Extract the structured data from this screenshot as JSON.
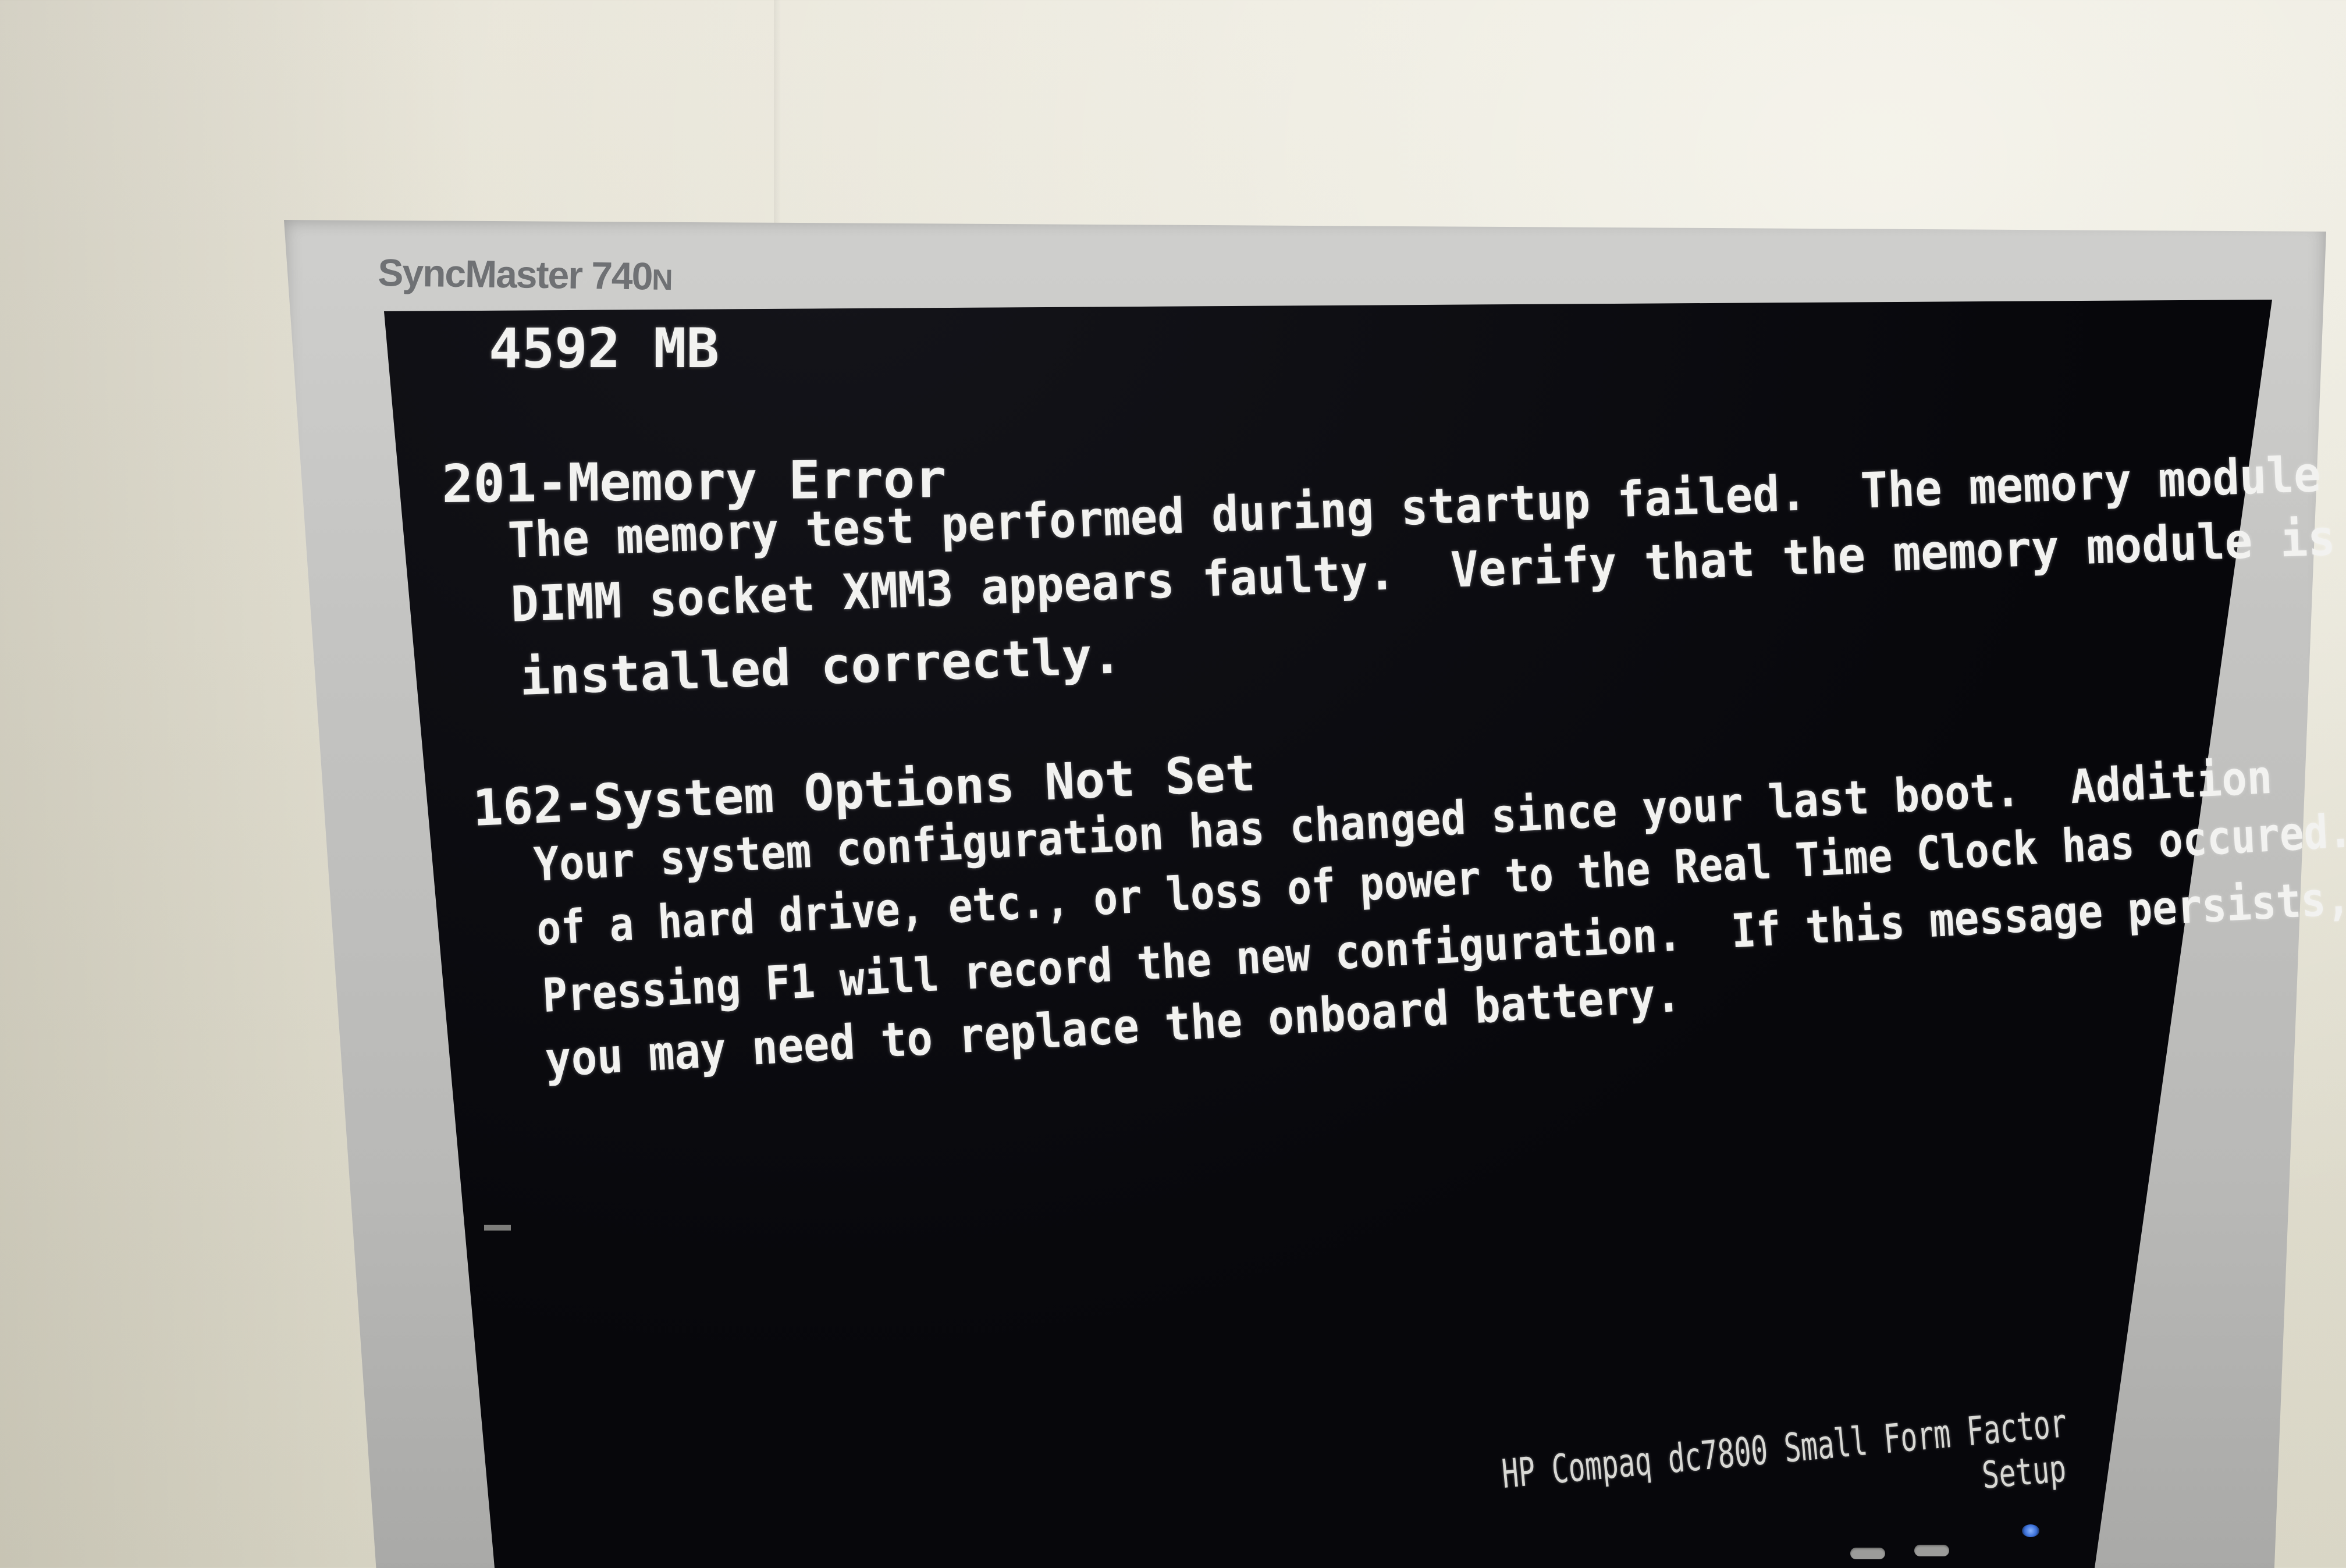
{
  "monitor": {
    "model_main": "SyncMaster 740",
    "model_suffix": "N"
  },
  "bios": {
    "memory_size": "4592 MB",
    "error1_title": "201-Memory Error",
    "error1_lines": [
      "The memory test performed during startup failed.  The memory module in",
      "DIMM socket XMM3 appears faulty.  Verify that the memory module is",
      "installed correctly."
    ],
    "error2_title": "162-System Options Not Set",
    "error2_lines": [
      "Your system configuration has changed since your last boot.  Addition",
      "of a hard drive, etc., or loss of power to the Real Time Clock has occured.",
      "Pressing F1 will record the new configuration.  If this message persists,",
      "you may need to replace the onboard battery."
    ],
    "product_name": "HP Compaq dc7800 Small Form Factor",
    "setup_label": "Setup"
  }
}
